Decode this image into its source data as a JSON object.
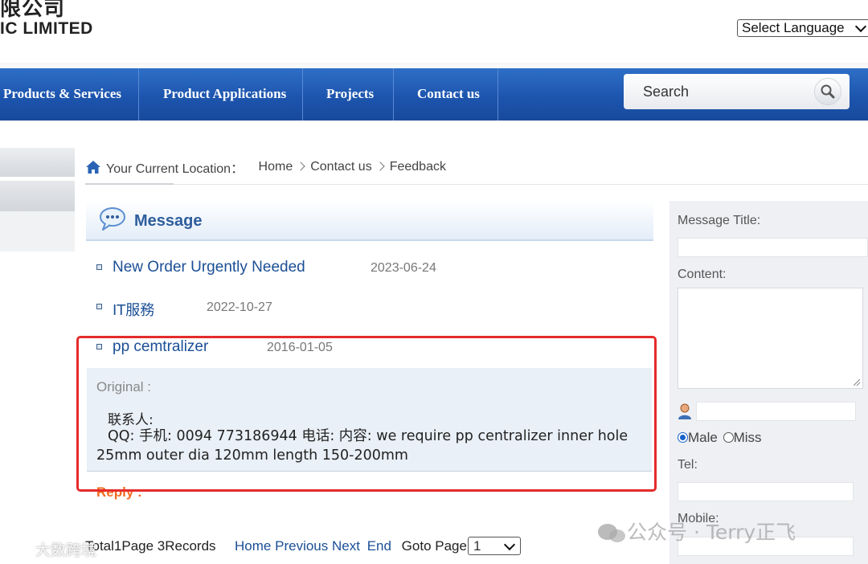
{
  "header": {
    "logo_cn": "限公司",
    "logo_en": "IC LIMITED",
    "language_select": "Select Language"
  },
  "nav": {
    "items": [
      {
        "label": "Products & Services"
      },
      {
        "label": "Product Applications"
      },
      {
        "label": "Projects"
      },
      {
        "label": "Contact us"
      }
    ],
    "search_placeholder": "Search",
    "search_icon": "magnifier-icon"
  },
  "breadcrumb": {
    "prefix": "Your Current Location：",
    "items": [
      "Home",
      "Contact us",
      "Feedback"
    ],
    "icon": "home-icon"
  },
  "message": {
    "heading": "Message",
    "icon": "speech-bubble-icon",
    "items": [
      {
        "title": "New Order Urgently Needed",
        "date": "2023-06-24"
      },
      {
        "title": "IT服務",
        "date": "2022-10-27"
      },
      {
        "title": "pp cemtralizer",
        "date": "2016-01-05"
      }
    ],
    "original_label": "Original :",
    "original_line1": "联系人:",
    "original_body": "QQ: 手机: 0094 773186944 电话:  内容:  we require pp centralizer inner hole 25mm outer dia 120mm length 150-200mm",
    "reply_label": "Reply :"
  },
  "pagination": {
    "summary": "Total1Page 3Records",
    "home": "Home",
    "previous": "Previous",
    "next": "Next",
    "end": "End",
    "goto_label": "Goto Page",
    "current_page": "1"
  },
  "form": {
    "title_label": "Message Title:",
    "content_label": "Content:",
    "name_icon": "user-icon",
    "gender_male": "Male",
    "gender_miss": "Miss",
    "gender_selected": "Male",
    "tel_label": "Tel:",
    "mobile_label": "Mobile:"
  },
  "watermarks": {
    "left": "大数跨境",
    "right": "公众号 · Terry正飞"
  },
  "colors": {
    "nav_blue": "#1d55ae",
    "link_blue": "#1b4f96",
    "reply_orange": "#f26a21",
    "highlight_red": "#e52b2b"
  }
}
